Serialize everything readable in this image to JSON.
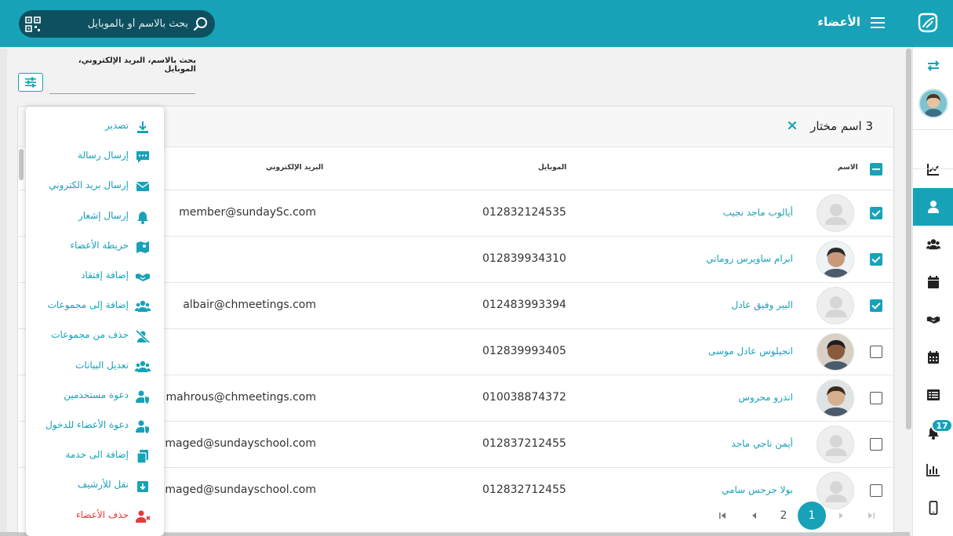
{
  "header": {
    "title": "الأعضاء",
    "search_placeholder": "بحث بالاسم أو بالموبايل"
  },
  "filter": {
    "label": "بحث بالاسم، البريد الإلكتروني، الموبايل"
  },
  "table": {
    "selected_summary": "3 اسم مختار",
    "columns": {
      "name": "الاسم",
      "mobile": "الموبايل",
      "email": "البريد الإلكتروني"
    },
    "rows": [
      {
        "name": "أيالوب ماجد نجيب",
        "mobile": "012832124535",
        "email": "member@sundaySc.com",
        "checked": true,
        "photo": false
      },
      {
        "name": "ابرام ساويرس روماني",
        "mobile": "012839934310",
        "email": "",
        "checked": true,
        "photo": true
      },
      {
        "name": "البير وفيق عادل",
        "mobile": "012483993394",
        "email": "albair@chmeetings.com",
        "checked": true,
        "photo": false
      },
      {
        "name": "انجيلوس عادل موسى",
        "mobile": "012839993405",
        "email": "",
        "checked": false,
        "photo": true
      },
      {
        "name": "اندرو محروس",
        "mobile": "010038874372",
        "email": "mahrous@chmeetings.com",
        "checked": false,
        "photo": true
      },
      {
        "name": "أيمن ناجي ماجد",
        "mobile": "012837212455",
        "email": "maged@sundayschool.com",
        "checked": false,
        "photo": false
      },
      {
        "name": "بولا جرجس سامي",
        "mobile": "012832712455",
        "email": "maged@sundayschool.com",
        "checked": false,
        "photo": false
      }
    ]
  },
  "pagination": {
    "current": "1",
    "next": "2"
  },
  "action_menu": [
    {
      "label": "تصدير",
      "icon": "download-icon"
    },
    {
      "label": "إرسال رسالة",
      "icon": "message-icon"
    },
    {
      "label": "إرسال بريد الكتروني",
      "icon": "envelope-icon"
    },
    {
      "label": "إرسال إشعار",
      "icon": "bell-icon"
    },
    {
      "label": "خريطة الأعضاء",
      "icon": "map-icon"
    },
    {
      "label": "إضافة إفتقاد",
      "icon": "handshake-icon"
    },
    {
      "label": "إضافة إلى مجموعات",
      "icon": "users-icon"
    },
    {
      "label": "حذف من مجموعات",
      "icon": "user-slash-icon"
    },
    {
      "label": "تعديل البيانات",
      "icon": "users-edit-icon"
    },
    {
      "label": "دعوة مستخدمين",
      "icon": "user-shield-icon"
    },
    {
      "label": "دعوة الأعضاء للدخول",
      "icon": "user-shield-icon"
    },
    {
      "label": "إضافة الى خدمة",
      "icon": "copy-icon"
    },
    {
      "label": "نقل للأرشيف",
      "icon": "archive-icon"
    },
    {
      "label": "حذف الأعضاء",
      "icon": "user-delete-icon"
    }
  ],
  "sidebar": {
    "notification_count": "17",
    "items": [
      "swap-icon",
      "profile-avatar",
      "dashboard-chart-icon",
      "member-icon",
      "groups-icon",
      "calendar-icon",
      "handshake-icon",
      "calendar-grid-icon",
      "list-icon",
      "bell-icon",
      "reports-icon",
      "mobile-icon"
    ]
  },
  "colors": {
    "primary": "#17a2b8",
    "header_search_bg": "#0f5060",
    "danger": "#e53935"
  }
}
